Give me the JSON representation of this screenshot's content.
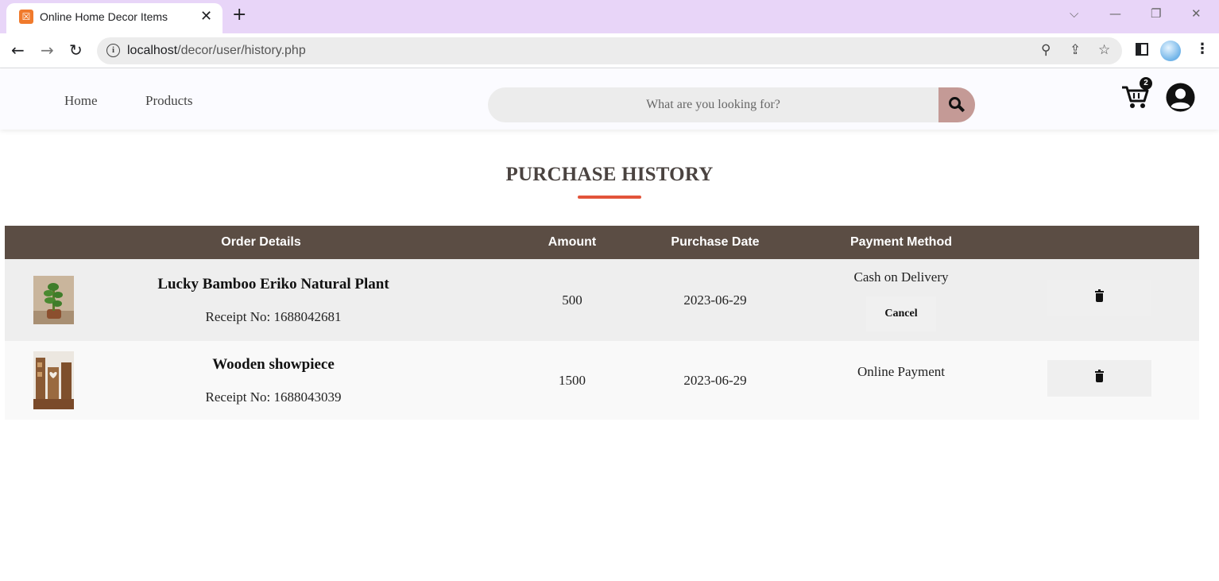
{
  "browser": {
    "tab_title": "Online Home Decor Items",
    "tab_close": "✕",
    "new_tab": "+",
    "url_host": "localhost",
    "url_path": "/decor/user/history.php",
    "window_controls": {
      "dropdown": "⌵",
      "minimize": "—",
      "restore": "❐",
      "close": "✕"
    }
  },
  "nav": {
    "home": "Home",
    "products": "Products"
  },
  "search": {
    "placeholder": "What are you looking for?",
    "value": ""
  },
  "cart": {
    "badge": "2"
  },
  "page": {
    "title": "PURCHASE HISTORY"
  },
  "table": {
    "headers": {
      "order_details": "Order Details",
      "amount": "Amount",
      "purchase_date": "Purchase Date",
      "payment_method": "Payment Method"
    },
    "rows": [
      {
        "name": "Lucky Bamboo Eriko Natural Plant",
        "receipt": "Receipt No: 1688042681",
        "amount": "500",
        "date": "2023-06-29",
        "payment": "Cash on Delivery",
        "cancel_label": "Cancel"
      },
      {
        "name": "Wooden showpiece",
        "receipt": "Receipt No: 1688043039",
        "amount": "1500",
        "date": "2023-06-29",
        "payment": "Online Payment"
      }
    ]
  },
  "colors": {
    "header_bar": "#5b4d44",
    "accent_underline": "#e2543a",
    "search_button": "#c49a96",
    "tabbar": "#e8d5f8"
  }
}
